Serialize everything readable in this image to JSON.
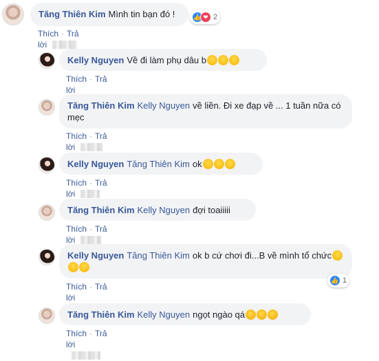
{
  "actions": {
    "like": "Thích",
    "reply": "Trả lời",
    "dot": "·"
  },
  "icons": {
    "like": "like-icon",
    "love": "love-icon",
    "smile": "smile-emoji-icon",
    "laugh": "laughing-tears-emoji-icon"
  },
  "comments": [
    {
      "author": "Tăng Thiên Kim",
      "tag": "",
      "text": "Mình tin bạn đó !",
      "reactions_count": "2"
    },
    {
      "author": "Kelly Nguyen",
      "tag": "",
      "text": "Về đi làm phụ dâu b"
    },
    {
      "author": "Tăng Thiên Kim",
      "tag": "Kelly Nguyen",
      "text": "về liền. Đi xe đạp về ... 1 tuần nữa có mẹc"
    },
    {
      "author": "Kelly Nguyen",
      "tag": "Tăng Thiên Kim",
      "text": "ok"
    },
    {
      "author": "Tăng Thiên Kim",
      "tag": "Kelly Nguyen",
      "text": "đợi toaiiiii"
    },
    {
      "author": "Kelly Nguyen",
      "tag": "Tăng Thiên Kim",
      "text": "ok b cứ chơi đi...B về mình tổ chức",
      "reactions_count": "1"
    },
    {
      "author": "Tăng Thiên Kim",
      "tag": "Kelly Nguyen",
      "text": "ngọt ngào qá"
    }
  ]
}
